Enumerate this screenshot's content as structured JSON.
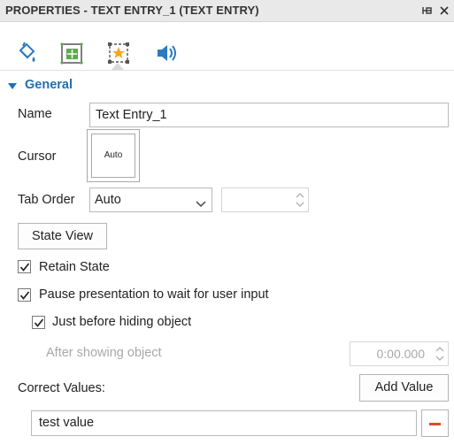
{
  "panel": {
    "title": "PROPERTIES - TEXT ENTRY_1 (TEXT ENTRY)",
    "pin_icon": "pin-icon",
    "close_icon": "close-icon"
  },
  "tabs": [
    {
      "icon": "paint-bucket-icon",
      "selected": false
    },
    {
      "icon": "position-size-icon",
      "selected": false
    },
    {
      "icon": "star-frame-icon",
      "selected": true
    },
    {
      "icon": "speaker-icon",
      "selected": false
    }
  ],
  "general": {
    "section_label": "General",
    "name_label": "Name",
    "name_value": "Text Entry_1",
    "cursor_label": "Cursor",
    "cursor_value": "Auto",
    "tab_order_label": "Tab Order",
    "tab_order_value": "Auto",
    "state_view_button": "State View",
    "retain_state_label": "Retain State",
    "retain_state_checked": true,
    "pause_label": "Pause presentation to wait for user input",
    "pause_checked": true,
    "before_hiding_label": "Just before hiding object",
    "before_hiding_checked": true,
    "after_showing_label": "After showing object",
    "after_showing_value": "0:00.000",
    "correct_values_label": "Correct Values:",
    "add_value_button": "Add Value",
    "correct_value_1": "test value"
  },
  "colors": {
    "accent": "#1f6fb4",
    "remove": "#e04a2a",
    "disabled_text": "#a8a8a8"
  }
}
